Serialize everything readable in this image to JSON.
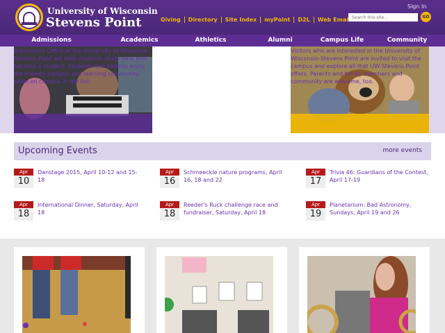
{
  "header": {
    "title_line1": "University of Wisconsin",
    "title_line2": "Stevens Point",
    "links": [
      "Giving",
      "Directory",
      "Site Index",
      "myPoint",
      "D2L",
      "Web Email"
    ],
    "sign_in": "Sign In",
    "search_placeholder": "Search this site...",
    "go_label": "GO",
    "colors": {
      "purple": "#4b2778",
      "gold": "#f2b800"
    }
  },
  "nav": {
    "items": [
      "Admissions",
      "Academics",
      "Athletics",
      "Alumni",
      "Campus Life",
      "Community"
    ]
  },
  "hero": {
    "left_text": "Admissions Office at the University of Wisconsin-Stevens Point will help students study here and become a student. Students and parents enjoy the friendly campus and learning community while on campus in the fall.",
    "right_text": "Visitors who are interested in the University of Wisconsin-Stevens Point are invited to visit the campus and explore all that UW-Stevens Point offers. Parents and family members and community are welcome, too."
  },
  "events": {
    "title": "Upcoming Events",
    "more": "more events",
    "items": [
      {
        "month": "Apr",
        "day": "10",
        "text": "Danstage 2015, April 10-12 and 15-18"
      },
      {
        "month": "Apr",
        "day": "16",
        "text": "Schmeeckle nature programs, April 16, 18 and 22"
      },
      {
        "month": "Apr",
        "day": "17",
        "text": "Trivia 46: Guardians of the Contest, April 17-19"
      },
      {
        "month": "Apr",
        "day": "18",
        "text": "International Dinner, Saturday, April 18"
      },
      {
        "month": "Apr",
        "day": "18",
        "text": "Reeder's Ruck challenge race and fundraiser, Saturday, April 18"
      },
      {
        "month": "Apr",
        "day": "19",
        "text": "Planetarium: Bad Astronomy, Sundays, April 19 and 26"
      }
    ]
  }
}
